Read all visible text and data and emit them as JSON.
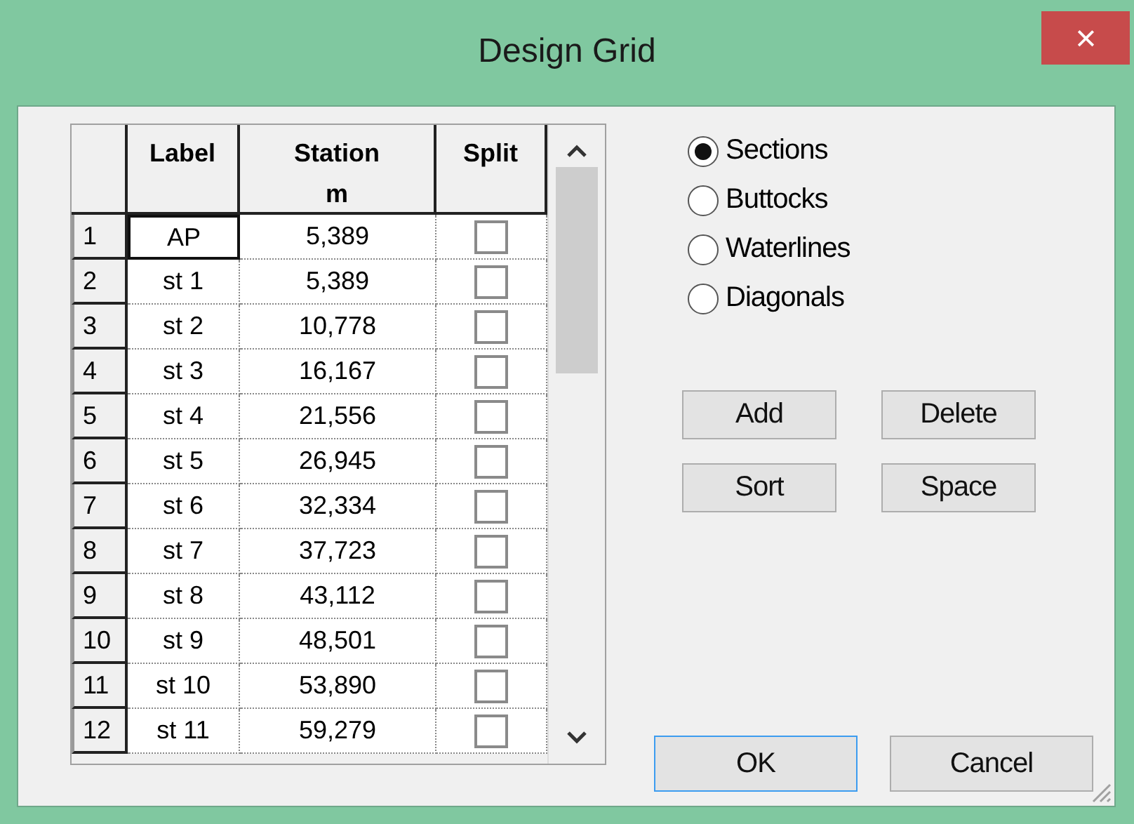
{
  "window": {
    "title": "Design Grid",
    "close": "×"
  },
  "grid": {
    "columns": [
      "Label",
      "Station\nm",
      "Split"
    ],
    "rows": [
      {
        "number": "1",
        "label": "AP",
        "station": "5,389",
        "split": false,
        "selected": true
      },
      {
        "number": "2",
        "label": "st 1",
        "station": "5,389",
        "split": false,
        "selected": false
      },
      {
        "number": "3",
        "label": "st 2",
        "station": "10,778",
        "split": false,
        "selected": false
      },
      {
        "number": "4",
        "label": "st 3",
        "station": "16,167",
        "split": false,
        "selected": false
      },
      {
        "number": "5",
        "label": "st 4",
        "station": "21,556",
        "split": false,
        "selected": false
      },
      {
        "number": "6",
        "label": "st 5",
        "station": "26,945",
        "split": false,
        "selected": false
      },
      {
        "number": "7",
        "label": "st 6",
        "station": "32,334",
        "split": false,
        "selected": false
      },
      {
        "number": "8",
        "label": "st 7",
        "station": "37,723",
        "split": false,
        "selected": false
      },
      {
        "number": "9",
        "label": "st 8",
        "station": "43,112",
        "split": false,
        "selected": false
      },
      {
        "number": "10",
        "label": "st 9",
        "station": "48,501",
        "split": false,
        "selected": false
      },
      {
        "number": "11",
        "label": "st 10",
        "station": "53,890",
        "split": false,
        "selected": false
      },
      {
        "number": "12",
        "label": "st 11",
        "station": "59,279",
        "split": false,
        "selected": false
      }
    ]
  },
  "options": [
    {
      "label": "Sections",
      "selected": true
    },
    {
      "label": "Buttocks",
      "selected": false
    },
    {
      "label": "Waterlines",
      "selected": false
    },
    {
      "label": "Diagonals",
      "selected": false
    }
  ],
  "actions": [
    "Add",
    "Delete",
    "Sort",
    "Space"
  ],
  "buttons": [
    {
      "label": "OK",
      "default": true
    },
    {
      "label": "Cancel",
      "default": false
    }
  ]
}
